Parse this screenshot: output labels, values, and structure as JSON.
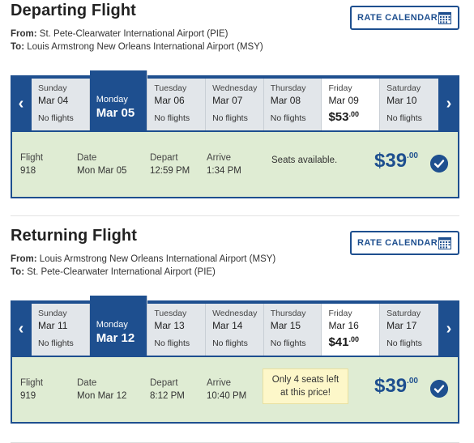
{
  "departing": {
    "title": "Departing Flight",
    "from_label": "From:",
    "from": "St. Pete-Clearwater International Airport (PIE)",
    "to_label": "To:",
    "to": "Louis Armstrong New Orleans International Airport (MSY)",
    "rate_calendar": "RATE CALENDAR",
    "days": [
      {
        "name": "Sunday",
        "date": "Mar 04",
        "status": "No flights"
      },
      {
        "name": "Monday",
        "date": "Mar 05",
        "status": "",
        "selected": true
      },
      {
        "name": "Tuesday",
        "date": "Mar 06",
        "status": "No flights"
      },
      {
        "name": "Wednesday",
        "date": "Mar 07",
        "status": "No flights"
      },
      {
        "name": "Thursday",
        "date": "Mar 08",
        "status": "No flights"
      },
      {
        "name": "Friday",
        "date": "Mar 09",
        "price_whole": "$53",
        "price_cents": ".00"
      },
      {
        "name": "Saturday",
        "date": "Mar 10",
        "status": "No flights"
      }
    ],
    "flight": {
      "flight_label": "Flight",
      "flight_number": "918",
      "date_label": "Date",
      "date": "Mon Mar 05",
      "depart_label": "Depart",
      "depart": "12:59 PM",
      "arrive_label": "Arrive",
      "arrive": "1:34 PM",
      "seats": "Seats available.",
      "price_whole": "$39",
      "price_cents": ".00"
    }
  },
  "returning": {
    "title": "Returning Flight",
    "from_label": "From:",
    "from": "Louis Armstrong New Orleans International Airport (MSY)",
    "to_label": "To:",
    "to": "St. Pete-Clearwater International Airport (PIE)",
    "rate_calendar": "RATE CALENDAR",
    "days": [
      {
        "name": "Sunday",
        "date": "Mar 11",
        "status": "No flights"
      },
      {
        "name": "Monday",
        "date": "Mar 12",
        "status": "",
        "selected": true
      },
      {
        "name": "Tuesday",
        "date": "Mar 13",
        "status": "No flights"
      },
      {
        "name": "Wednesday",
        "date": "Mar 14",
        "status": "No flights"
      },
      {
        "name": "Thursday",
        "date": "Mar 15",
        "status": "No flights"
      },
      {
        "name": "Friday",
        "date": "Mar 16",
        "price_whole": "$41",
        "price_cents": ".00"
      },
      {
        "name": "Saturday",
        "date": "Mar 17",
        "status": "No flights"
      }
    ],
    "flight": {
      "flight_label": "Flight",
      "flight_number": "919",
      "date_label": "Date",
      "date": "Mon Mar 12",
      "depart_label": "Depart",
      "depart": "8:12 PM",
      "arrive_label": "Arrive",
      "arrive": "10:40 PM",
      "seats_line1": "Only 4 seats left",
      "seats_line2": "at this price!",
      "price_whole": "$39",
      "price_cents": ".00"
    }
  },
  "icons": {
    "prev": "chevron-left-icon",
    "next": "chevron-right-icon",
    "calendar": "calendar-icon",
    "selected": "check-circle-icon"
  },
  "colors": {
    "brand": "#1e4f8f",
    "selected_flight_bg": "#dfecd3",
    "notice_bg": "#fdf7c9"
  }
}
